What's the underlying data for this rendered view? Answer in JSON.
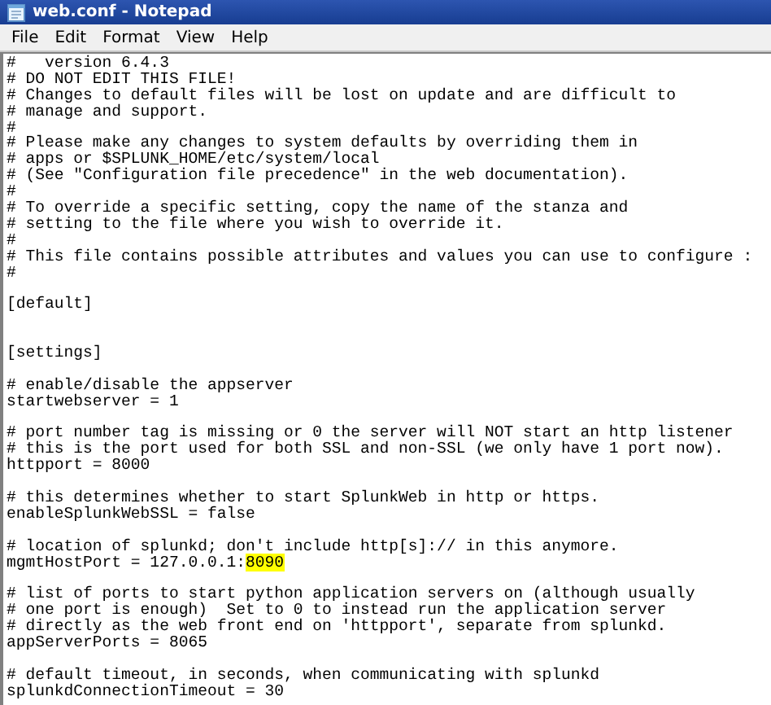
{
  "window": {
    "title": "web.conf - Notepad"
  },
  "menu": [
    "File",
    "Edit",
    "Format",
    "View",
    "Help"
  ],
  "lines": [
    {
      "kind": "text",
      "text": "#   version 6.4.3"
    },
    {
      "kind": "text",
      "text": "# DO NOT EDIT THIS FILE!"
    },
    {
      "kind": "text",
      "text": "# Changes to default files will be lost on update and are difficult to"
    },
    {
      "kind": "text",
      "text": "# manage and support."
    },
    {
      "kind": "text",
      "text": "#"
    },
    {
      "kind": "text",
      "text": "# Please make any changes to system defaults by overriding them in"
    },
    {
      "kind": "text",
      "text": "# apps or $SPLUNK_HOME/etc/system/local"
    },
    {
      "kind": "text",
      "text": "# (See \"Configuration file precedence\" in the web documentation)."
    },
    {
      "kind": "text",
      "text": "#"
    },
    {
      "kind": "text",
      "text": "# To override a specific setting, copy the name of the stanza and"
    },
    {
      "kind": "text",
      "text": "# setting to the file where you wish to override it."
    },
    {
      "kind": "text",
      "text": "#"
    },
    {
      "kind": "text",
      "text": "# This file contains possible attributes and values you can use to configure :"
    },
    {
      "kind": "text",
      "text": "#"
    },
    {
      "kind": "blank"
    },
    {
      "kind": "text",
      "text": "[default]"
    },
    {
      "kind": "blank"
    },
    {
      "kind": "blank"
    },
    {
      "kind": "text",
      "text": "[settings]"
    },
    {
      "kind": "blank"
    },
    {
      "kind": "text",
      "text": "# enable/disable the appserver"
    },
    {
      "kind": "text",
      "text": "startwebserver = 1"
    },
    {
      "kind": "blank"
    },
    {
      "kind": "text",
      "text": "# port number tag is missing or 0 the server will NOT start an http listener"
    },
    {
      "kind": "text",
      "text": "# this is the port used for both SSL and non-SSL (we only have 1 port now)."
    },
    {
      "kind": "text",
      "text": "httpport = 8000"
    },
    {
      "kind": "blank"
    },
    {
      "kind": "text",
      "text": "# this determines whether to start SplunkWeb in http or https."
    },
    {
      "kind": "text",
      "text": "enableSplunkWebSSL = false"
    },
    {
      "kind": "blank"
    },
    {
      "kind": "text",
      "text": "# location of splunkd; don't include http[s]:// in this anymore."
    },
    {
      "kind": "parts",
      "parts": [
        {
          "text": "mgmtHostPort = 127.0.0.1:",
          "highlighted": false
        },
        {
          "text": "8090",
          "highlighted": true
        }
      ]
    },
    {
      "kind": "blank"
    },
    {
      "kind": "text",
      "text": "# list of ports to start python application servers on (although usually"
    },
    {
      "kind": "text",
      "text": "# one port is enough)  Set to 0 to instead run the application server"
    },
    {
      "kind": "text",
      "text": "# directly as the web front end on 'httpport', separate from splunkd."
    },
    {
      "kind": "text",
      "text": "appServerPorts = 8065"
    },
    {
      "kind": "blank"
    },
    {
      "kind": "text",
      "text": "# default timeout, in seconds, when communicating with splunkd"
    },
    {
      "kind": "text",
      "text": "splunkdConnectionTimeout = 30"
    }
  ]
}
